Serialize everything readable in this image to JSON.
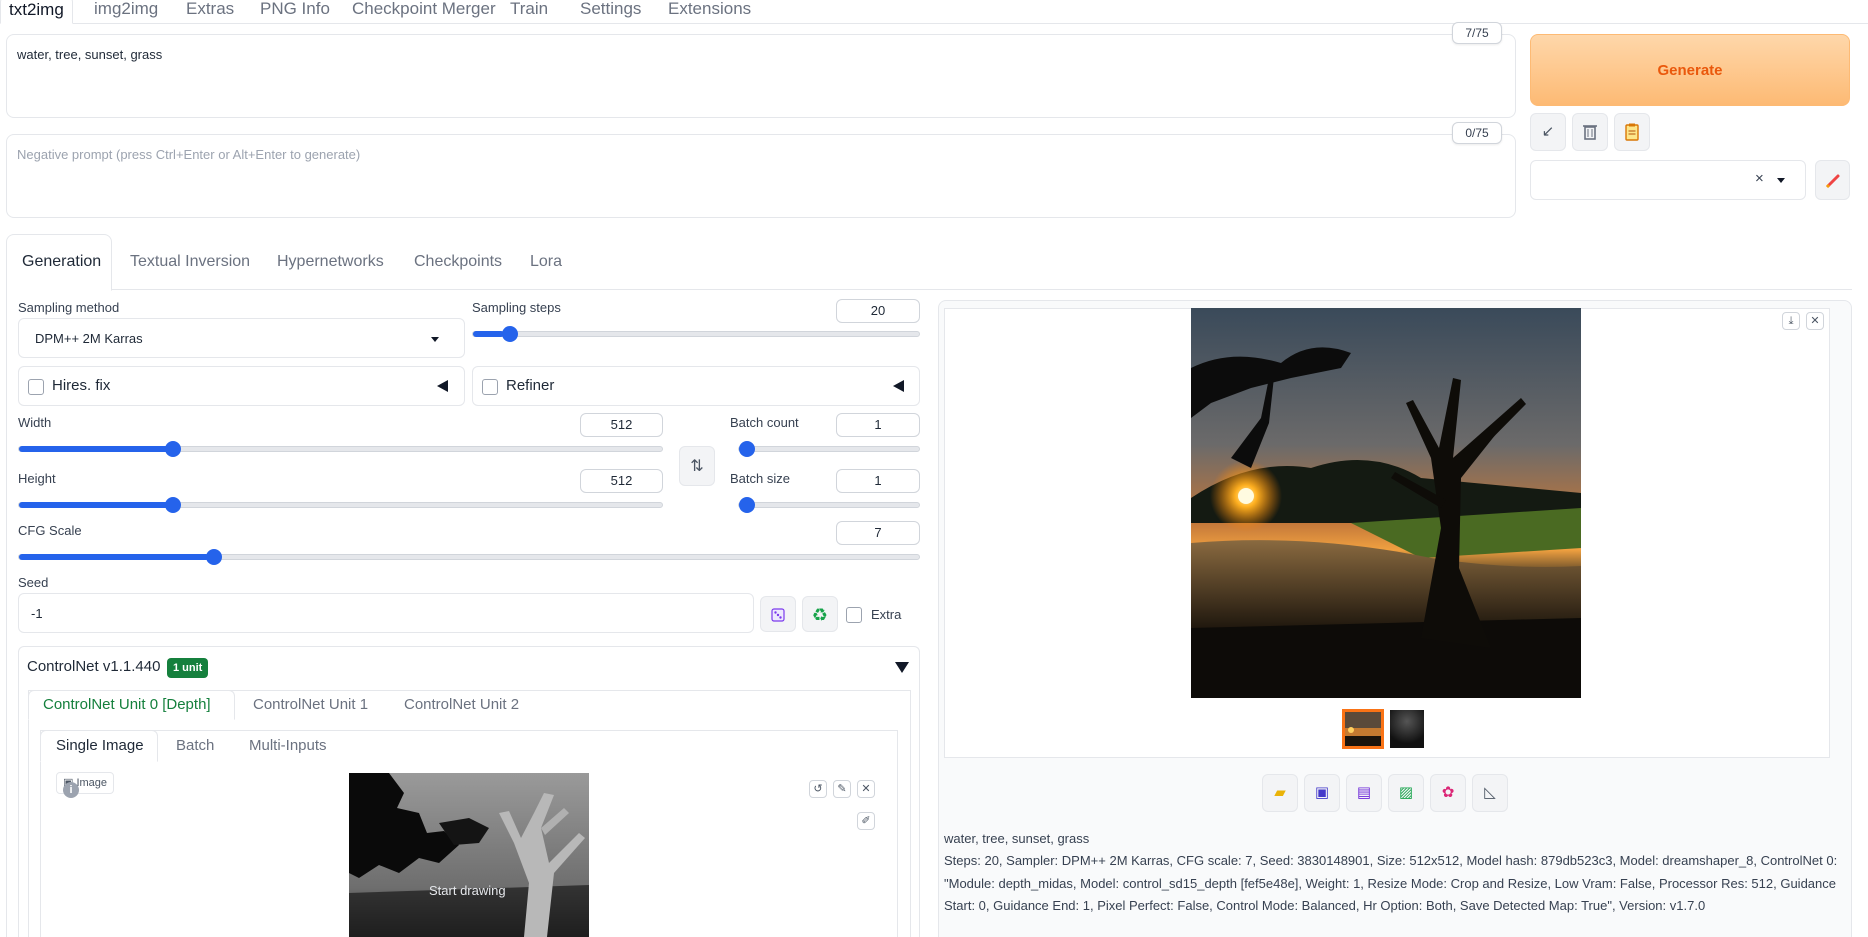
{
  "top_tabs": [
    "txt2img",
    "img2img",
    "Extras",
    "PNG Info",
    "Checkpoint Merger",
    "Train",
    "Settings",
    "Extensions"
  ],
  "prompt": {
    "value": "water, tree, sunset, grass",
    "counter": "7/75"
  },
  "negative_prompt": {
    "placeholder": "Negative prompt (press Ctrl+Enter or Alt+Enter to generate)",
    "counter": "0/75"
  },
  "generate_label": "Generate",
  "tool_icons": [
    "arrow-icon",
    "trash-icon",
    "clipboard-icon"
  ],
  "styles_clear": "×",
  "section_tabs": [
    "Generation",
    "Textual Inversion",
    "Hypernetworks",
    "Checkpoints",
    "Lora"
  ],
  "sampling": {
    "method_label": "Sampling method",
    "method_value": "DPM++ 2M Karras",
    "steps_label": "Sampling steps",
    "steps_value": "20",
    "steps_fraction": 0.0684
  },
  "hires_label": "Hires. fix",
  "refiner_label": "Refiner",
  "width": {
    "label": "Width",
    "value": "512",
    "fraction": 0.2326
  },
  "height": {
    "label": "Height",
    "value": "512",
    "fraction": 0.2326
  },
  "batch_count": {
    "label": "Batch count",
    "value": "1",
    "fraction": 0.0
  },
  "batch_size": {
    "label": "Batch size",
    "value": "1",
    "fraction": 0.0
  },
  "cfg": {
    "label": "CFG Scale",
    "value": "7",
    "fraction": 0.2115
  },
  "seed": {
    "label": "Seed",
    "value": "-1",
    "extra_label": "Extra"
  },
  "controlnet": {
    "title": "ControlNet v1.1.440",
    "badge": "1 unit",
    "unit_tabs": [
      "ControlNet Unit 0 [Depth]",
      "ControlNet Unit 1",
      "ControlNet Unit 2"
    ],
    "input_tabs": [
      "Single Image",
      "Batch",
      "Multi-Inputs"
    ],
    "image_label": "Image",
    "start_drawing": "Start drawing"
  },
  "output": {
    "caption": "water, tree, sunset, grass",
    "info": "Steps: 20, Sampler: DPM++ 2M Karras, CFG scale: 7, Seed: 3830148901, Size: 512x512, Model hash: 879db523c3, Model: dreamshaper_8, ControlNet 0: \"Module: depth_midas, Model: control_sd15_depth [fef5e48e], Weight: 1, Resize Mode: Crop and Resize, Low Vram: False, Processor Res: 512, Guidance Start: 0, Guidance End: 1, Pixel Perfect: False, Control Mode: Balanced, Hr Option: Both, Save Detected Map: True\", Version: v1.7.0",
    "action_icons": [
      "folder-icon",
      "save-icon",
      "zip-icon",
      "image-send-icon",
      "palette-icon",
      "ruler-icon"
    ]
  },
  "colors": {
    "accent": "#2563eb",
    "generate_text": "#ea580c",
    "controlnet_green": "#15803d"
  }
}
